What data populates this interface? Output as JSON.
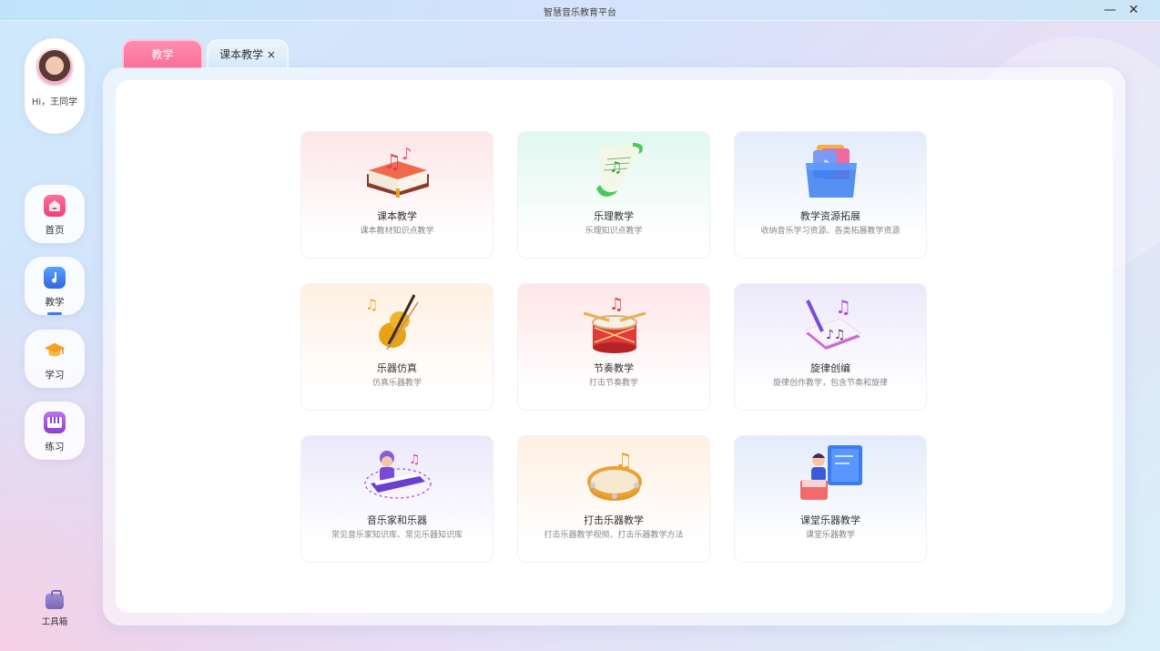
{
  "app": {
    "title": "智慧音乐教育平台",
    "minimize": "—",
    "close": "✕"
  },
  "sidebar": {
    "greeting": "Hi，王同学",
    "items": [
      {
        "label": "首页",
        "icon": "home-icon",
        "color": "#f5457d"
      },
      {
        "label": "教学",
        "icon": "music-note-icon",
        "color": "#3d78e6"
      },
      {
        "label": "学习",
        "icon": "graduation-cap-icon",
        "color": "#f59c1f"
      },
      {
        "label": "练习",
        "icon": "piano-keys-icon",
        "color": "#a04fd8"
      }
    ],
    "active_item": "教学",
    "toolbox_label": "工具箱"
  },
  "tabs": [
    {
      "label": "教学",
      "active": true
    },
    {
      "label": "课本教学 ×",
      "active": false
    }
  ],
  "cards": [
    {
      "title": "课本教学",
      "subtitle": "课本教材知识点教学",
      "icon": "music-book-icon"
    },
    {
      "title": "乐理教学",
      "subtitle": "乐理知识点教学",
      "icon": "sheet-music-scroll-icon"
    },
    {
      "title": "教学资源拓展",
      "subtitle": "收纳音乐学习资源、各类拓展教学资源",
      "icon": "resource-folder-icon"
    },
    {
      "title": "乐器仿真",
      "subtitle": "仿真乐器教学",
      "icon": "violin-icon"
    },
    {
      "title": "节奏教学",
      "subtitle": "打击节奏教学",
      "icon": "drum-icon"
    },
    {
      "title": "旋律创编",
      "subtitle": "旋律创作教学，包含节奏和旋律",
      "icon": "composition-pen-icon"
    },
    {
      "title": "音乐家和乐器",
      "subtitle": "常见音乐家知识库、常见乐器知识库",
      "icon": "musician-keyboard-icon"
    },
    {
      "title": "打击乐器教学",
      "subtitle": "打击乐器教学视频、打击乐器教学方法",
      "icon": "tambourine-icon"
    },
    {
      "title": "课堂乐器教学",
      "subtitle": "课堂乐器教学",
      "icon": "classroom-teacher-icon"
    }
  ]
}
